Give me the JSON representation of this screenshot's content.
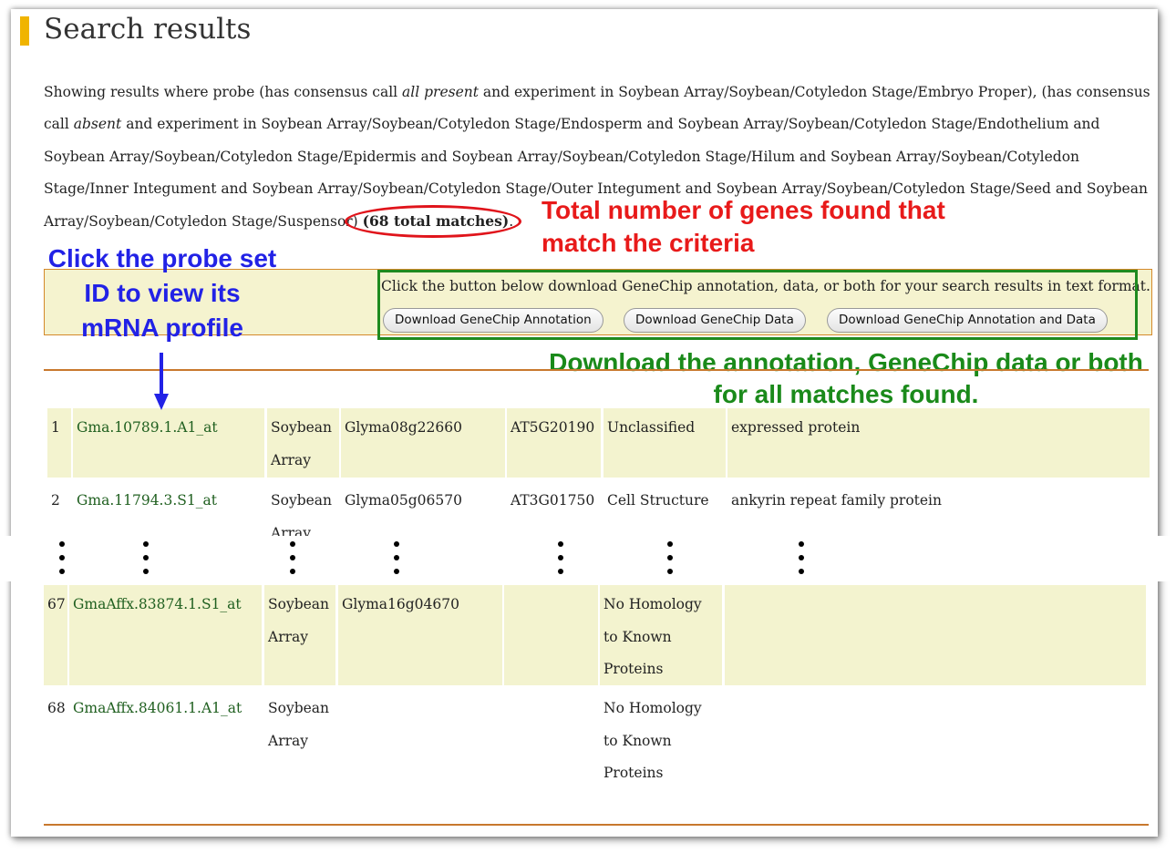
{
  "page": {
    "title": "Search results",
    "description_parts": {
      "p1": "Showing results where probe (has consensus call ",
      "p2": "all present",
      "p3": " and experiment in Soybean Array/Soybean/Cotyledon Stage/Embryo Proper), (has consensus call ",
      "p4": "absent",
      "p5": " and experiment in Soybean Array/Soybean/Cotyledon Stage/Endosperm and Soybean Array/Soybean/Cotyledon Stage/Endothelium and Soybean Array/Soybean/Cotyledon Stage/Epidermis and Soybean Array/Soybean/Cotyledon Stage/Hilum and Soybean Array/Soybean/Cotyledon Stage/Inner Integument and Soybean Array/Soybean/Cotyledon Stage/Outer Integument and Soybean Array/Soybean/Cotyledon Stage/Seed and Soybean Array/Soybean/Cotyledon Stage/Suspensor) ",
      "p6": "(68 total matches)",
      "p7": "."
    }
  },
  "annotations": {
    "total_genes": "Total number of genes found that match the criteria",
    "click_probe": "Click the probe set ID to view its mRNA profile",
    "download_note": "Download the annotation, GeneChip data or both for all matches found."
  },
  "download": {
    "instruction": "Click the button below download GeneChip annotation, data, or both for your search results in text format.",
    "btn_annotation": "Download GeneChip Annotation",
    "btn_data": "Download GeneChip Data",
    "btn_both": "Download GeneChip Annotation and Data"
  },
  "results": [
    {
      "num": "1",
      "probe": "Gma.10789.1.A1_at",
      "array": "Soybean Array",
      "gene": "Glyma08g22660",
      "agi": "AT5G20190",
      "category": "Unclassified",
      "description": "expressed protein"
    },
    {
      "num": "2",
      "probe": "Gma.11794.3.S1_at",
      "array": "Soybean Array",
      "gene": "Glyma05g06570",
      "agi": "AT3G01750",
      "category": "Cell Structure",
      "description": "ankyrin repeat family protein"
    },
    {
      "num": "67",
      "probe": "GmaAffx.83874.1.S1_at",
      "array": "Soybean Array",
      "gene": "Glyma16g04670",
      "agi": "",
      "category": "No Homology to Known Proteins",
      "description": ""
    },
    {
      "num": "68",
      "probe": "GmaAffx.84061.1.A1_at",
      "array": "Soybean Array",
      "gene": "",
      "agi": "",
      "category": "No Homology to Known Proteins",
      "description": ""
    }
  ]
}
